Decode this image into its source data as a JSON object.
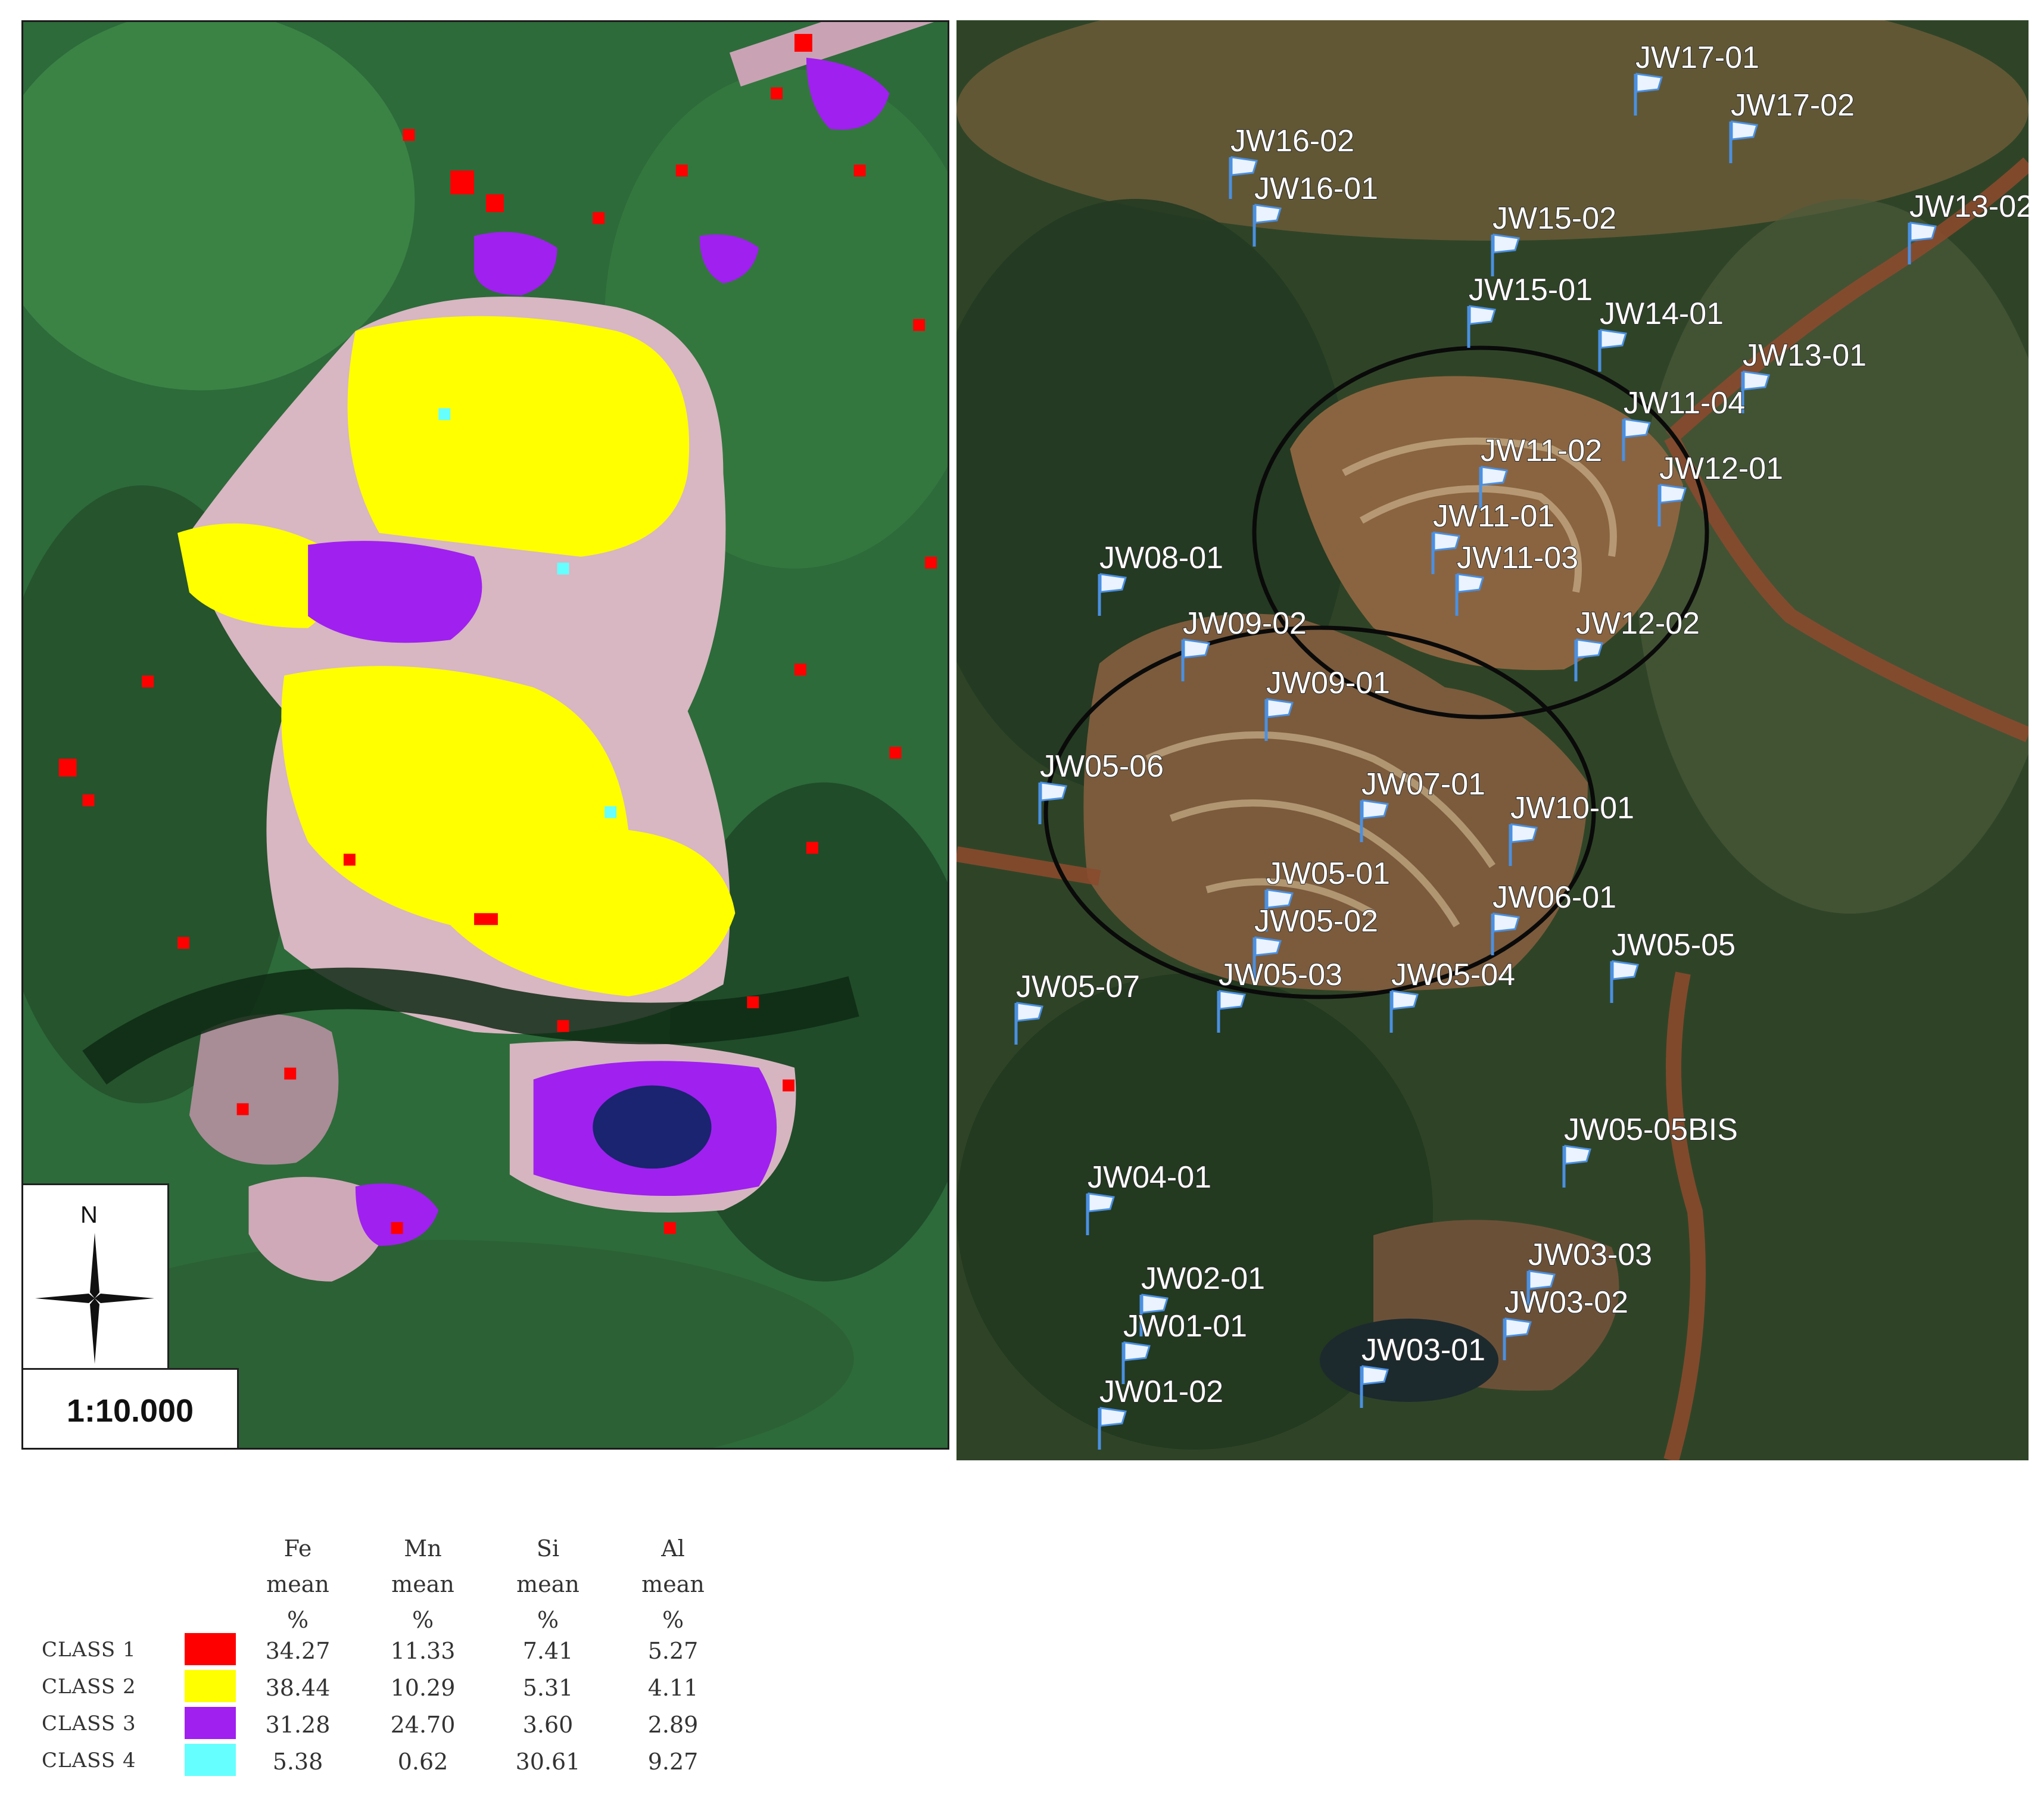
{
  "left_panel": {
    "north_label": "N",
    "scale_label": "1:10.000"
  },
  "right_panel": {
    "samples": [
      "JW17-01",
      "JW17-02",
      "JW16-02",
      "JW16-01",
      "JW15-02",
      "JW13-02",
      "JW15-01",
      "JW14-01",
      "JW13-01",
      "JW11-04",
      "JW11-02",
      "JW12-01",
      "JW11-01",
      "JW11-03",
      "JW08-01",
      "JW09-02",
      "JW12-02",
      "JW09-01",
      "JW05-06",
      "JW07-01",
      "JW10-01",
      "JW05-01",
      "JW06-01",
      "JW05-02",
      "JW05-05",
      "JW05-03",
      "JW05-04",
      "JW05-07",
      "JW05-05BIS",
      "JW04-01",
      "JW03-03",
      "JW02-01",
      "JW03-02",
      "JW01-01",
      "JW03-01",
      "JW01-02"
    ]
  },
  "legend": {
    "headers": [
      {
        "element": "Fe",
        "stat": "mean",
        "unit": "%"
      },
      {
        "element": "Mn",
        "stat": "mean",
        "unit": "%"
      },
      {
        "element": "Si",
        "stat": "mean",
        "unit": "%"
      },
      {
        "element": "Al",
        "stat": "mean",
        "unit": "%"
      }
    ],
    "classes": [
      {
        "label": "CLASS 1",
        "color": "#ff0000",
        "values": [
          "34.27",
          "11.33",
          "7.41",
          "5.27"
        ]
      },
      {
        "label": "CLASS 2",
        "color": "#ffff00",
        "values": [
          "38.44",
          "10.29",
          "5.31",
          "4.11"
        ]
      },
      {
        "label": "CLASS 3",
        "color": "#a020f0",
        "values": [
          "31.28",
          "24.70",
          "3.60",
          "2.89"
        ]
      },
      {
        "label": "CLASS 4",
        "color": "#66ffff",
        "values": [
          "5.38",
          "0.62",
          "30.61",
          "9.27"
        ]
      }
    ]
  }
}
